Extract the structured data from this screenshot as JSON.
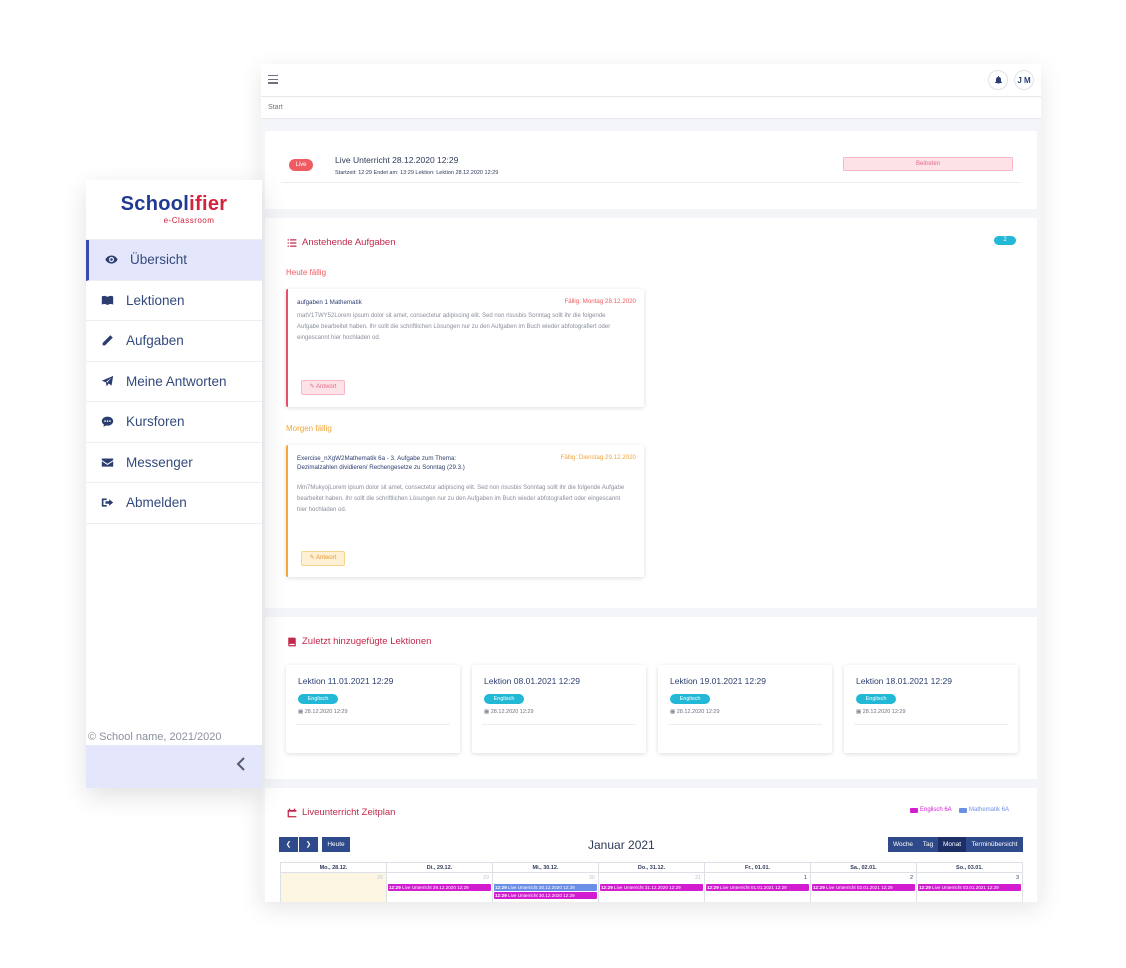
{
  "logo": {
    "main_left": "School",
    "main_right": "ifier",
    "sub": "e-Classroom"
  },
  "sidebar": {
    "items": [
      {
        "label": "Übersicht",
        "icon": "eye-icon"
      },
      {
        "label": "Lektionen",
        "icon": "book-icon"
      },
      {
        "label": "Aufgaben",
        "icon": "pencil-icon"
      },
      {
        "label": "Meine Antworten",
        "icon": "paper-plane-icon"
      },
      {
        "label": "Kursforen",
        "icon": "chat-icon"
      },
      {
        "label": "Messenger",
        "icon": "envelope-icon"
      },
      {
        "label": "Abmelden",
        "icon": "sign-out-icon"
      }
    ],
    "footer": "© School name,  2021/2020"
  },
  "topbar": {
    "avatar": "J M"
  },
  "breadcrumb": "Start",
  "live": {
    "badge": "Live",
    "title": "Live Unterricht 28.12.2020 12:29",
    "meta": "Startzeit: 12:29 Endet am: 13:29 Lektion: Lektion 28.12.2020 12:29",
    "join": "Beitreten"
  },
  "tasks": {
    "title": "Anstehende Aufgaben",
    "count": "2",
    "today_label": "Heute fällig",
    "tomorrow_label": "Morgen fällig",
    "items": [
      {
        "title": "aufgaben 1 Mathematik",
        "due": "Fällig: Montag 28.12.2020",
        "body": "matV1TWY52Lorem ipsum dolor sit amet, consectetur adipiscing elit. Sed non risusbis Sonntag sollt ihr die folgende Aufgabe bearbeitet haben. Ihr sollt die schriftlichen Lösungen nur zu den Aufgaben im Buch wieder abfotografiert oder eingescannt hier hochladen od.",
        "answer": "Antwort"
      },
      {
        "title": "Exercise_nXgW2Mathematik 6a - 3. Aufgabe zum Thema: Dezimalzahlen dividieren/ Rechengesetze zu Sonntag (29.3.)",
        "due": "Fällig: Dienstag 29.12.2020",
        "body": "Mm7MukyojLorem ipsum dolor sit amet, consectetur adipiscing elit. Sed non risusbis Sonntag sollt ihr die folgende Aufgabe bearbeitet haben. Ihr sollt die schriftlichen Lösungen nur zu den Aufgaben im Buch wieder abfotografiert oder eingescannt hier hochladen od.",
        "answer": "Antwort"
      }
    ]
  },
  "lessons": {
    "title": "Zuletzt hinzugefügte Lektionen",
    "items": [
      {
        "title": "Lektion 11.01.2021 12:29",
        "tag": "Englisch",
        "date": "28.12.2020 12:29"
      },
      {
        "title": "Lektion 08.01.2021 12:29",
        "tag": "Englisch",
        "date": "28.12.2020 12:29"
      },
      {
        "title": "Lektion 19.01.2021 12:29",
        "tag": "Englisch",
        "date": "28.12.2020 12:29"
      },
      {
        "title": "Lektion 18.01.2021 12:29",
        "tag": "Englisch",
        "date": "28.12.2020 12:29"
      }
    ]
  },
  "calendar": {
    "title": "Liveunterricht Zeitplan",
    "legend": [
      {
        "label": "Englisch 6A",
        "color": "#d11ccf"
      },
      {
        "label": "Mathematik 6A",
        "color": "#6b8fe6"
      }
    ],
    "today_btn": "Heute",
    "month": "Januar 2021",
    "views": [
      "Woche",
      "Tag",
      "Monat",
      "Terminübersicht"
    ],
    "headers": [
      "Mo., 28.12.",
      "Di., 29.12.",
      "Mi., 30.12.",
      "Do., 31.12.",
      "Fr., 01.01.",
      "Sa., 02.01.",
      "So., 03.01."
    ],
    "days": [
      {
        "num": "28",
        "prev": true,
        "events": []
      },
      {
        "num": "29",
        "prev": true,
        "events": [
          {
            "time": "12:29",
            "text": "Live Unterricht 29.12.2020 12:29",
            "color": "#d11ccf"
          }
        ]
      },
      {
        "num": "30",
        "prev": true,
        "events": [
          {
            "time": "12:29",
            "text": "Live Unterricht 30.12.2020 12:29",
            "color": "#6b8fe6"
          },
          {
            "time": "12:29",
            "text": "Live Unterricht 30.12.2020 12:29",
            "color": "#d11ccf"
          }
        ]
      },
      {
        "num": "31",
        "prev": true,
        "events": [
          {
            "time": "12:29",
            "text": "Live Unterricht 31.12.2020 12:29",
            "color": "#d11ccf"
          }
        ]
      },
      {
        "num": "1",
        "prev": false,
        "events": [
          {
            "time": "12:29",
            "text": "Live Unterricht 01.01.2021 12:29",
            "color": "#d11ccf"
          }
        ]
      },
      {
        "num": "2",
        "prev": false,
        "events": [
          {
            "time": "12:29",
            "text": "Live Unterricht 02.01.2021 12:29",
            "color": "#d11ccf"
          }
        ]
      },
      {
        "num": "3",
        "prev": false,
        "events": [
          {
            "time": "12:29",
            "text": "Live Unterricht 03.01.2021 12:29",
            "color": "#d11ccf"
          }
        ]
      }
    ]
  }
}
